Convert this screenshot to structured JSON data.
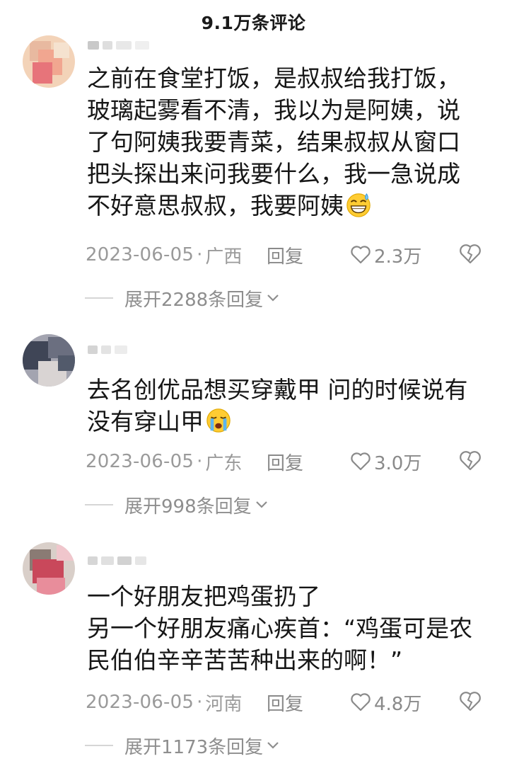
{
  "header": {
    "title": "9.1万条评论"
  },
  "comments": [
    {
      "text_lines": [
        "之前在食堂打饭，是叔叔给我打饭，",
        "玻璃起雾看不清，我以为是阿姨，说",
        "了句阿姨我要青菜，结果叔叔从窗口",
        "把头探出来问我要什么，我一急说成",
        "不好意思叔叔，我要阿姨"
      ],
      "emoji": "grinning-sweat-emoji",
      "date": "2023-06-05",
      "location": "广西",
      "reply_label": "回复",
      "likes": "2.3万",
      "expand_label": "展开2288条回复",
      "avatar_colors": [
        "#e8b9a0",
        "#f3d3b8",
        "#f1a690",
        "#e7747a",
        "#f5e2cf"
      ]
    },
    {
      "text_lines": [
        "去名创优品想买穿戴甲 问的时候说有",
        "没有穿山甲"
      ],
      "emoji": "crying-emoji",
      "date": "2023-06-05",
      "location": "广东",
      "reply_label": "回复",
      "likes": "3.0万",
      "expand_label": "展开998条回复",
      "avatar_colors": [
        "#3f4556",
        "#6b6f80",
        "#a3a4b0",
        "#d9d4d3",
        "#525a6b"
      ]
    },
    {
      "text_lines": [
        "一个好朋友把鸡蛋扔了",
        "另一个好朋友痛心疾首：“鸡蛋可是农",
        "民伯伯辛辛苦苦种出来的啊！”"
      ],
      "emoji": "",
      "date": "2023-06-05",
      "location": "河南",
      "reply_label": "回复",
      "likes": "4.8万",
      "expand_label": "展开1173条回复",
      "avatar_colors": [
        "#d9cfc9",
        "#c9485b",
        "#e88d9b",
        "#8a7b74",
        "#f0c6cc"
      ]
    }
  ],
  "icons": {
    "like": "heart-outline-icon",
    "dislike": "broken-heart-icon",
    "expand": "chevron-down-icon"
  },
  "colors": {
    "text": "#161616",
    "meta": "#9a9a9a",
    "divider": "#d6d6d6"
  }
}
